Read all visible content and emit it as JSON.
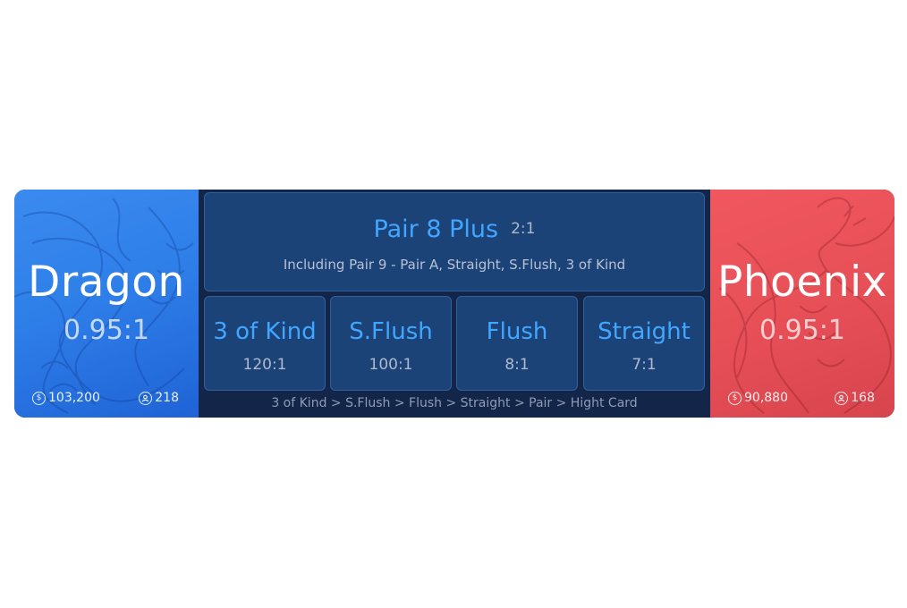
{
  "dragon": {
    "title": "Dragon",
    "odds": "0.95:1",
    "amount": "103,200",
    "players": "218"
  },
  "phoenix": {
    "title": "Phoenix",
    "odds": "0.95:1",
    "amount": "90,880",
    "players": "168"
  },
  "pair_bet": {
    "name": "Pair 8 Plus",
    "ratio": "2:1",
    "description": "Including Pair 9 - Pair A, Straight, S.Flush, 3 of Kind"
  },
  "hand_bets": [
    {
      "name": "3 of Kind",
      "ratio": "120:1"
    },
    {
      "name": "S.Flush",
      "ratio": "100:1"
    },
    {
      "name": "Flush",
      "ratio": "8:1"
    },
    {
      "name": "Straight",
      "ratio": "7:1"
    }
  ],
  "ranking": "3 of Kind > S.Flush > Flush > Straight > Pair > Hight Card",
  "icons": {
    "amount": "dollar-coin-icon",
    "players": "user-icon"
  },
  "colors": {
    "dragon": "#2f7fe9",
    "phoenix": "#e85058",
    "center_bg": "#13264a",
    "cell_bg": "#1c4377",
    "accent": "#41a6ff"
  }
}
